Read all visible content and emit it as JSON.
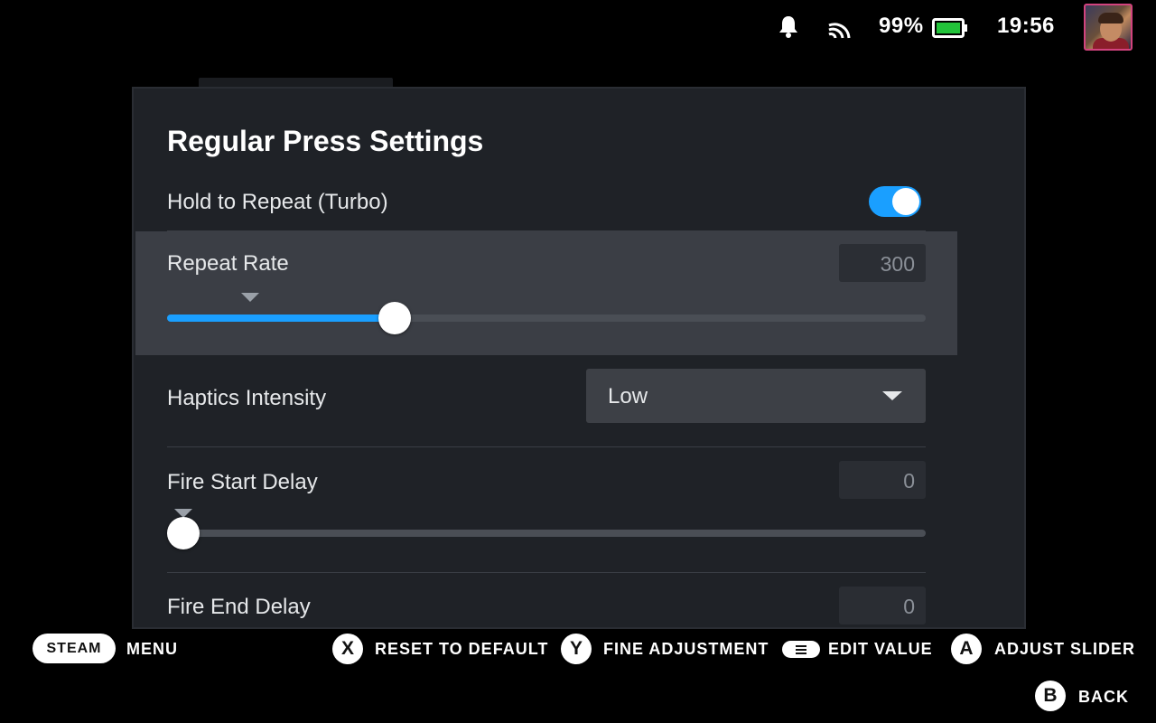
{
  "status": {
    "battery_percent": "99%",
    "battery_level": 0.99,
    "time": "19:56",
    "icons": [
      "bell-icon",
      "wifi-icon",
      "battery-icon",
      "avatar"
    ]
  },
  "modal": {
    "title": "Regular Press Settings",
    "hold_to_repeat": {
      "label": "Hold to Repeat (Turbo)",
      "enabled": true
    },
    "repeat_rate": {
      "label": "Repeat Rate",
      "value": "300",
      "slider_fraction": 0.3,
      "default_marker_fraction": 0.11
    },
    "haptics_intensity": {
      "label": "Haptics Intensity",
      "value": "Low"
    },
    "fire_start_delay": {
      "label": "Fire Start Delay",
      "value": "0",
      "slider_fraction": 0.0,
      "default_marker_fraction": 0.0
    },
    "fire_end_delay": {
      "label": "Fire End Delay",
      "value": "0"
    }
  },
  "footer": {
    "steam_label": "STEAM",
    "menu_label": "MENU",
    "x_glyph": "X",
    "reset_label": "RESET TO DEFAULT",
    "y_glyph": "Y",
    "fine_label": "FINE ADJUSTMENT",
    "edit_label": "EDIT VALUE",
    "a_glyph": "A",
    "adjust_label": "ADJUST SLIDER",
    "b_glyph": "B",
    "back_label": "BACK"
  },
  "colors": {
    "accent": "#1a9fff",
    "modal_bg": "#1f2227",
    "highlight_bg": "#3b3e45"
  }
}
